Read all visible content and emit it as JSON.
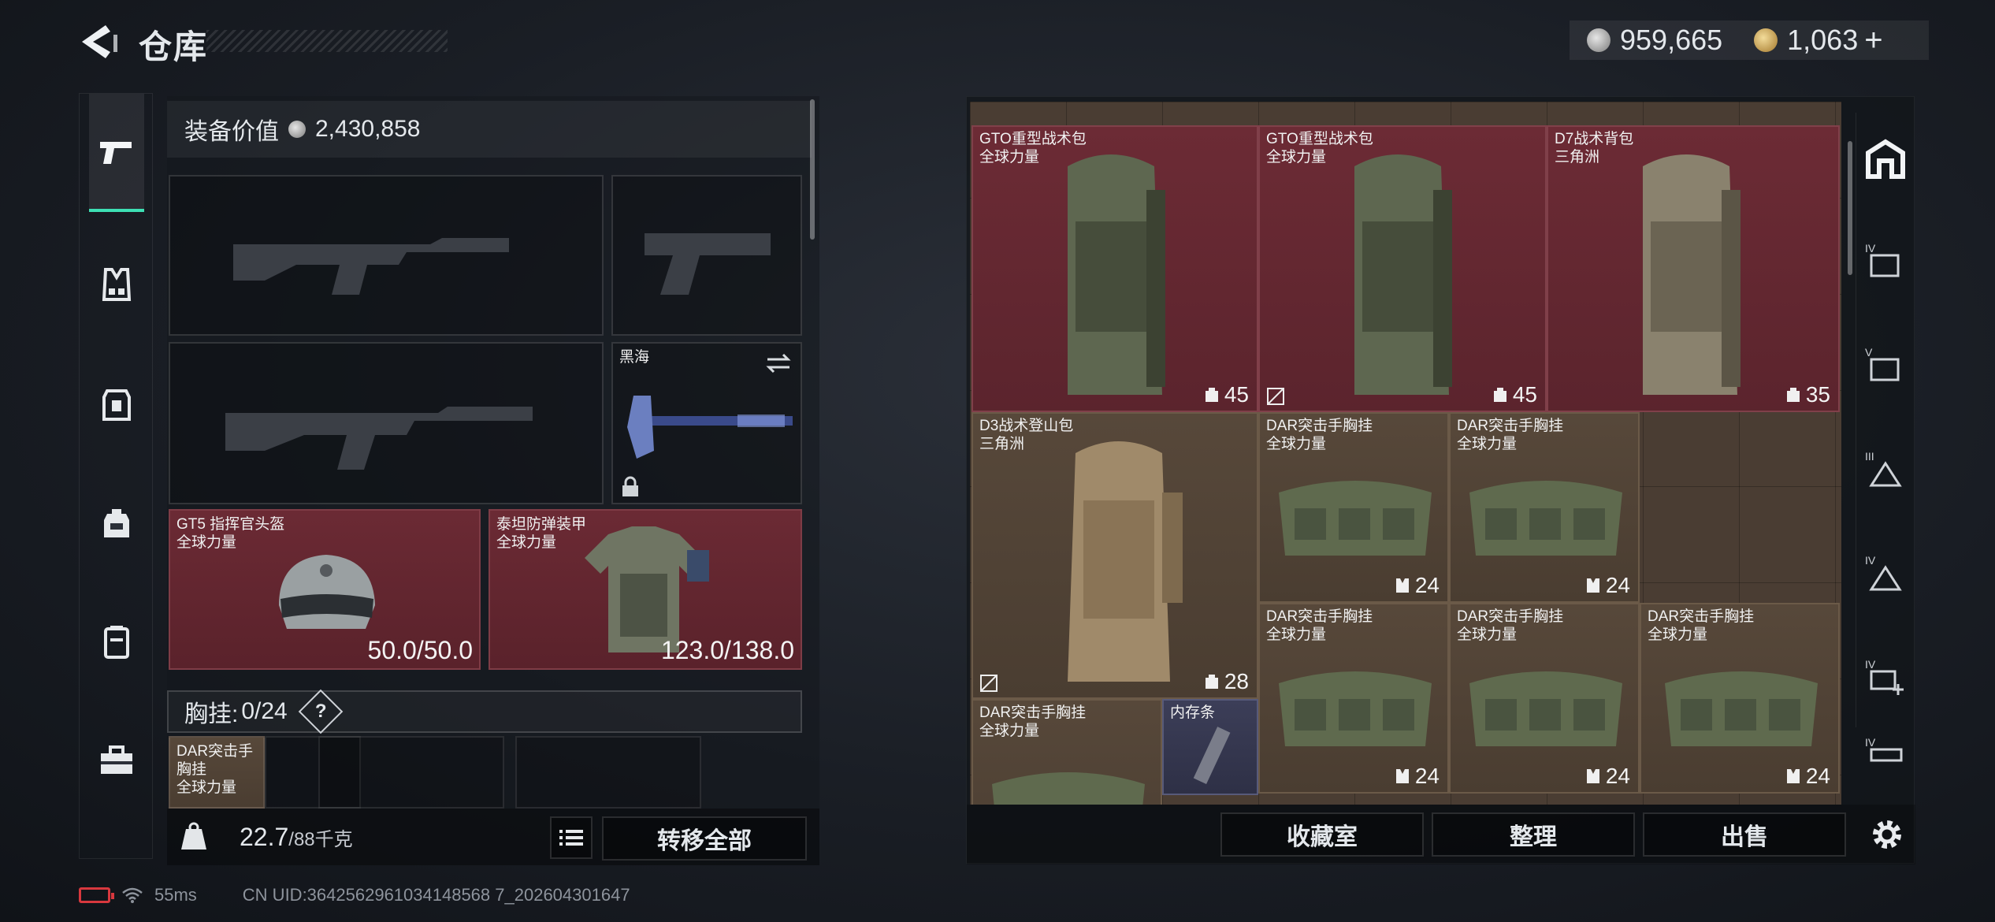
{
  "header": {
    "title": "仓库",
    "currency": [
      {
        "type": "silver",
        "value": "959,665"
      },
      {
        "type": "gold",
        "value": "1,063"
      }
    ],
    "add_label": "+"
  },
  "nav": {
    "items": [
      {
        "icon": "pistol-icon",
        "active": true
      },
      {
        "icon": "vest-icon",
        "active": false
      },
      {
        "icon": "backpack-icon",
        "active": false
      },
      {
        "icon": "bag-icon",
        "active": false
      },
      {
        "icon": "case-icon",
        "active": false
      },
      {
        "icon": "toolbox-icon",
        "active": false
      }
    ]
  },
  "loadout": {
    "equip_value_label": "装备价值",
    "equip_value": "2,430,858",
    "melee": {
      "name": "黑海"
    },
    "helmet": {
      "name": "GT5 指挥官头盔",
      "faction": "全球力量",
      "durability": "50.0/50.0"
    },
    "armor": {
      "name": "泰坦防弹装甲",
      "faction": "全球力量",
      "durability": "123.0/138.0"
    },
    "chest_rig": {
      "label": "胸挂:",
      "value": "0/24",
      "help": "?"
    },
    "rig_item": {
      "name": "DAR突击手胸挂",
      "faction": "全球力量"
    },
    "weight": {
      "current": "22.7",
      "max": "/88千克"
    },
    "transfer_all_label": "转移全部"
  },
  "storage": {
    "items": [
      {
        "name": "GTO重型战术包",
        "faction": "全球力量",
        "capacity": "45",
        "color": "red"
      },
      {
        "name": "GTO重型战术包",
        "faction": "全球力量",
        "capacity": "45",
        "color": "red",
        "flag": true
      },
      {
        "name": "D7战术背包",
        "faction": "三角洲",
        "capacity": "35",
        "color": "red"
      },
      {
        "name": "D3战术登山包",
        "faction": "三角洲",
        "capacity": "28",
        "color": "brown",
        "flag": true
      },
      {
        "name": "DAR突击手胸挂",
        "faction": "全球力量",
        "capacity": "24",
        "color": "brown"
      },
      {
        "name": "DAR突击手胸挂",
        "faction": "全球力量",
        "capacity": "24",
        "color": "brown"
      },
      {
        "name": "DAR突击手胸挂",
        "faction": "全球力量",
        "capacity": "24",
        "color": "brown"
      },
      {
        "name": "DAR突击手胸挂",
        "faction": "全球力量",
        "capacity": "24",
        "color": "brown"
      },
      {
        "name": "DAR突击手胸挂",
        "faction": "全球力量",
        "capacity": "24",
        "color": "brown"
      },
      {
        "name": "DAR突击手胸挂",
        "faction": "全球力量",
        "capacity": "",
        "color": "brown"
      },
      {
        "name": "内存条",
        "faction": "",
        "capacity": "",
        "color": "purple"
      }
    ],
    "buttons": {
      "collection": "收藏室",
      "organize": "整理",
      "sell": "出售"
    },
    "filters": [
      "home-icon",
      "tier-IV-icon",
      "tier-V-icon",
      "tier-III-icon",
      "tier-IV-icon",
      "tier-IV-plus-icon",
      "tier-IV-icon"
    ]
  },
  "status": {
    "ping": "55ms",
    "uid": "CN UID:3642562961034148568 7_202604301647"
  }
}
